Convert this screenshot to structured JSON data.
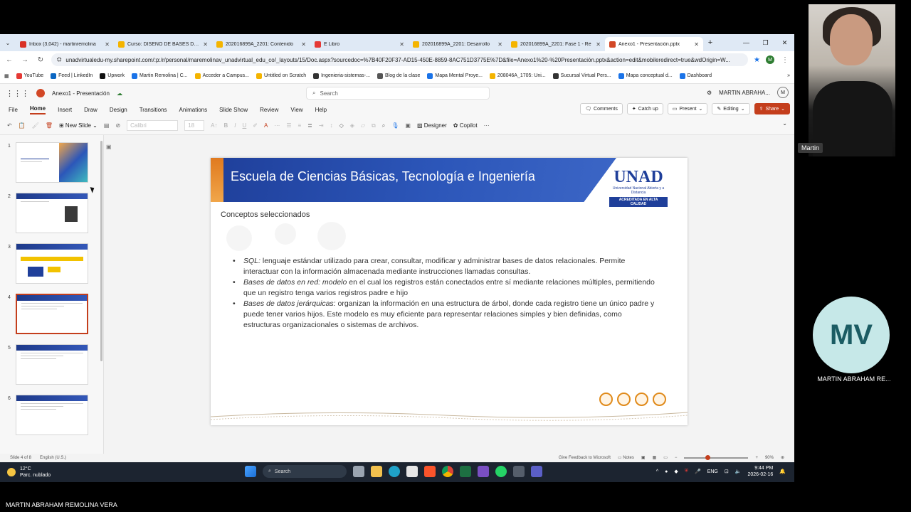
{
  "browser": {
    "tabs": [
      {
        "title": "Inbox (3,042) - martinremolina",
        "color": "#d93025",
        "active": false
      },
      {
        "title": "Curso: DISEÑO DE BASES DE D",
        "color": "#f4b400",
        "active": false
      },
      {
        "title": "202016899A_2201: Contenido",
        "color": "#f4b400",
        "active": false
      },
      {
        "title": "E Libro",
        "color": "#e53935",
        "active": false
      },
      {
        "title": "202016899A_2201: Desarrollo",
        "color": "#f4b400",
        "active": false
      },
      {
        "title": "202016899A_2201: Fase 1 - Re",
        "color": "#f4b400",
        "active": false
      },
      {
        "title": "Anexo1 - Presentación.pptx",
        "color": "#d24726",
        "active": true
      }
    ],
    "url": "unadvirtualedu-my.sharepoint.com/:p:/r/personal/maremolinav_unadvirtual_edu_co/_layouts/15/Doc.aspx?sourcedoc=%7B40F20F37-AD15-450E-8859-8AC751D3775E%7D&file=Anexo1%20-%20Presentación.pptx&action=edit&mobileredirect=true&wdOrigin=W...",
    "profile": "M",
    "bookmarks": [
      {
        "label": "YouTube",
        "color": "#e53935"
      },
      {
        "label": "Feed | LinkedIn",
        "color": "#0a66c2"
      },
      {
        "label": "Upwork",
        "color": "#111111"
      },
      {
        "label": "Martin Remolina | C...",
        "color": "#1a73e8"
      },
      {
        "label": "Acceder a Campus...",
        "color": "#f4b400"
      },
      {
        "label": "Untitled on Scratch",
        "color": "#f4b400"
      },
      {
        "label": "Ingenieria-sistemas-...",
        "color": "#333333"
      },
      {
        "label": "Blog de la clase",
        "color": "#555555"
      },
      {
        "label": "Mapa Mental Proye...",
        "color": "#1a73e8"
      },
      {
        "label": "208046A_1705: Uni...",
        "color": "#f4b400"
      },
      {
        "label": "Sucursal Virtual Pers...",
        "color": "#333333"
      },
      {
        "label": "Mapa conceptual d...",
        "color": "#1a73e8"
      },
      {
        "label": "Dashboard",
        "color": "#1a73e8"
      }
    ]
  },
  "office": {
    "doc_title": "Anexo1 - Presentación",
    "search_placeholder": "Search",
    "user_name": "MARTIN ABRAHA...",
    "user_initial": "M",
    "menu": [
      "File",
      "Home",
      "Insert",
      "Draw",
      "Design",
      "Transitions",
      "Animations",
      "Slide Show",
      "Review",
      "View",
      "Help"
    ],
    "active_menu": "Home",
    "buttons": {
      "comments": "Comments",
      "catchup": "Catch up",
      "present": "Present",
      "editing": "Editing",
      "share": "Share"
    },
    "toolbar": {
      "new_slide": "New Slide",
      "font": "Calibri",
      "size": "18",
      "designer": "Designer",
      "copilot": "Copilot"
    }
  },
  "slides": {
    "numbers": [
      "1",
      "2",
      "3",
      "4",
      "5",
      "6"
    ],
    "selected": 4,
    "current": {
      "title": "Escuela de Ciencias Básicas, Tecnología e Ingeniería",
      "subtitle": "Conceptos seleccionados",
      "logo": "UNAD",
      "logo_sub": "Universidad Nacional Abierta y a Distancia",
      "logo_badge": "ACREDITADA EN ALTA CALIDAD",
      "bullets": [
        {
          "term": "SQL:",
          "text": " lenguaje estándar utilizado para crear, consultar, modificar y administrar bases de datos relacionales. Permite interactuar con la información almacenada mediante instrucciones llamadas consultas."
        },
        {
          "term": "Bases de datos en red: modelo",
          "text": " en el cual los registros están conectados entre sí mediante relaciones múltiples, permitiendo que un registro tenga varios registros padre e hijo"
        },
        {
          "term": "Bases de datos jerárquicas:",
          "text": " organizan la información en una estructura de árbol, donde cada registro tiene un único padre y puede tener varios hijos. Este modelo es muy eficiente para representar relaciones simples y bien definidas, como estructuras organizacionales o sistemas de archivos."
        }
      ]
    }
  },
  "statusbar": {
    "slide_info": "Slide 4 of 8",
    "language": "English (U.S.)",
    "feedback": "Give Feedback to Microsoft",
    "notes": "Notes",
    "zoom": "90%"
  },
  "taskbar": {
    "temp": "12°C",
    "weather": "Parc. nublado",
    "search": "Search",
    "lang": "ENG",
    "time": "9:44 PM",
    "date": "2026-02-16"
  },
  "call": {
    "cam_name": "Martin",
    "tile_initials": "MV",
    "tile_name": "MARTIN ABRAHAM RE...",
    "bottom_name": "MARTIN ABRAHAM REMOLINA VERA"
  }
}
